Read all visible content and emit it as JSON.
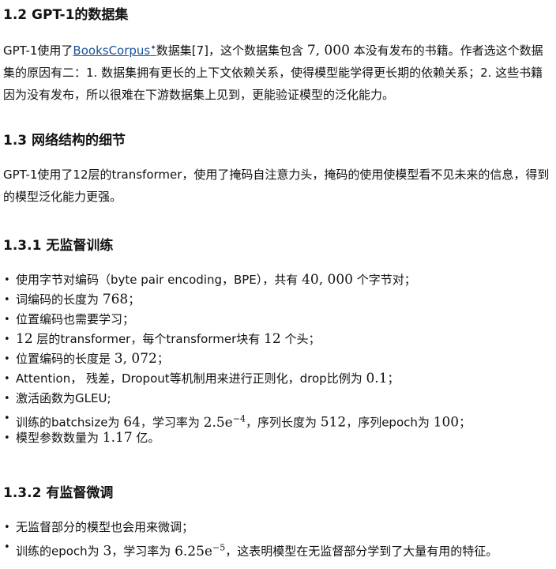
{
  "section_1_2": {
    "title": "1.2 GPT-1的数据集",
    "p_before_link": "GPT-1使用了",
    "link_text": "BooksCorpus",
    "link_mark": "✦",
    "p_after_link": "数据集[7]，这个数据集包含 ",
    "count": "7, 000",
    "p_rest": " 本没有发布的书籍。作者选这个数据集的原因有二：1. 数据集拥有更长的上下文依赖关系，使得模型能学得更长期的依赖关系；2. 这些书籍因为没有发布，所以很难在下游数据集上见到，更能验证模型的泛化能力。"
  },
  "section_1_3": {
    "title": "1.3 网络结构的细节",
    "text": "GPT-1使用了12层的transformer，使用了掩码自注意力头，掩码的使用使模型看不见未来的信息，得到的模型泛化能力更强。"
  },
  "section_1_3_1": {
    "title": "1.3.1 无监督训练",
    "items": {
      "b1_pre": "使用字节对编码（byte pair encoding，BPE），共有 ",
      "b1_num": "40, 000",
      "b1_post": " 个字节对；",
      "b2_pre": "词编码的长度为 ",
      "b2_num": "768",
      "b2_post": "；",
      "b3": "位置编码也需要学习；",
      "b4_num1": "12",
      "b4_mid": " 层的transformer，每个transformer块有 ",
      "b4_num2": "12",
      "b4_post": " 个头；",
      "b5_pre": "位置编码的长度是 ",
      "b5_num": "3, 072",
      "b5_post": "；",
      "b6_pre": "Attention， 残差，Dropout等机制用来进行正则化，drop比例为 ",
      "b6_num": "0.1",
      "b6_post": "；",
      "b7": "激活函数为GLEU;",
      "b8_pre": "训练的batchsize为 ",
      "b8_num1": "64",
      "b8_mid1": "，学习率为 ",
      "b8_lr": "2.5e",
      "b8_exp": "−4",
      "b8_mid2": "，序列长度为 ",
      "b8_num2": "512",
      "b8_mid3": "，序列epoch为 ",
      "b8_num3": "100",
      "b8_post": "；",
      "b9_pre": "模型参数数量为 ",
      "b9_num": "1.17",
      "b9_post": " 亿。"
    }
  },
  "section_1_3_2": {
    "title": "1.3.2 有监督微调",
    "items": {
      "b1": "无监督部分的模型也会用来微调；",
      "b2_pre": "训练的epoch为 ",
      "b2_num": "3",
      "b2_mid": "，学习率为 ",
      "b2_lr": "6.25e",
      "b2_exp": "−5",
      "b2_post": "，这表明模型在无监督部分学到了大量有用的特征。"
    }
  }
}
